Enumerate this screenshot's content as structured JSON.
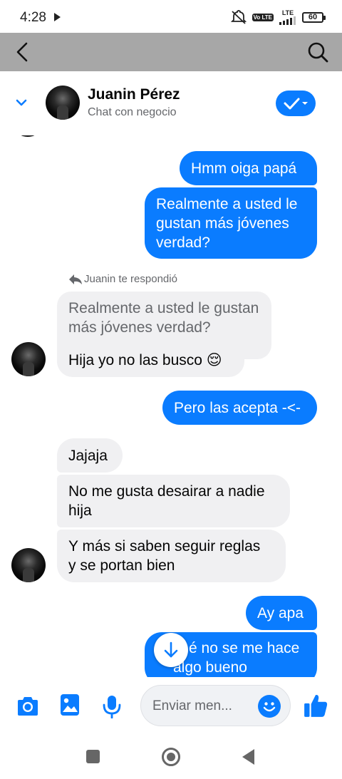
{
  "status_bar": {
    "time": "4:28",
    "network": "LTE",
    "volte": "Vo LTE",
    "battery": "60"
  },
  "header": {
    "contact_name": "Juanin Pérez",
    "contact_subtitle": "Chat con negocio"
  },
  "colors": {
    "accent": "#0a7cff",
    "top_bar": "#a7a7a7",
    "incoming_bubble": "#f0f0f2"
  },
  "messages": {
    "out_1": "Hmm oiga papá",
    "out_2": [
      "Realmente a usted le",
      "gustan más jóvenes",
      "verdad?"
    ],
    "reply_note": "Juanin te respondió",
    "quoted": [
      "Realmente a usted le gustan",
      "más jóvenes verdad?"
    ],
    "in_1": "Hija yo no las busco 😌",
    "out_3": "Pero las acepta -<-",
    "in_2": "Jajaja",
    "in_3": [
      "No me gusta desairar a nadie",
      "hija"
    ],
    "in_4": [
      "Y más si saben seguir reglas",
      "y se portan bien"
    ],
    "out_4": "Ay apa",
    "out_5": [
      "é no se me hace",
      "algo bueno"
    ]
  },
  "composer": {
    "placeholder": "Enviar men..."
  },
  "icons": {
    "back": "arrow-left-icon",
    "search": "search-icon",
    "collapse": "chevron-down-icon",
    "status": "check-icon",
    "camera": "camera-icon",
    "gallery": "image-icon",
    "mic": "microphone-icon",
    "emoji": "smiley-icon",
    "like": "thumbs-up-icon",
    "scroll": "arrow-down-icon"
  }
}
